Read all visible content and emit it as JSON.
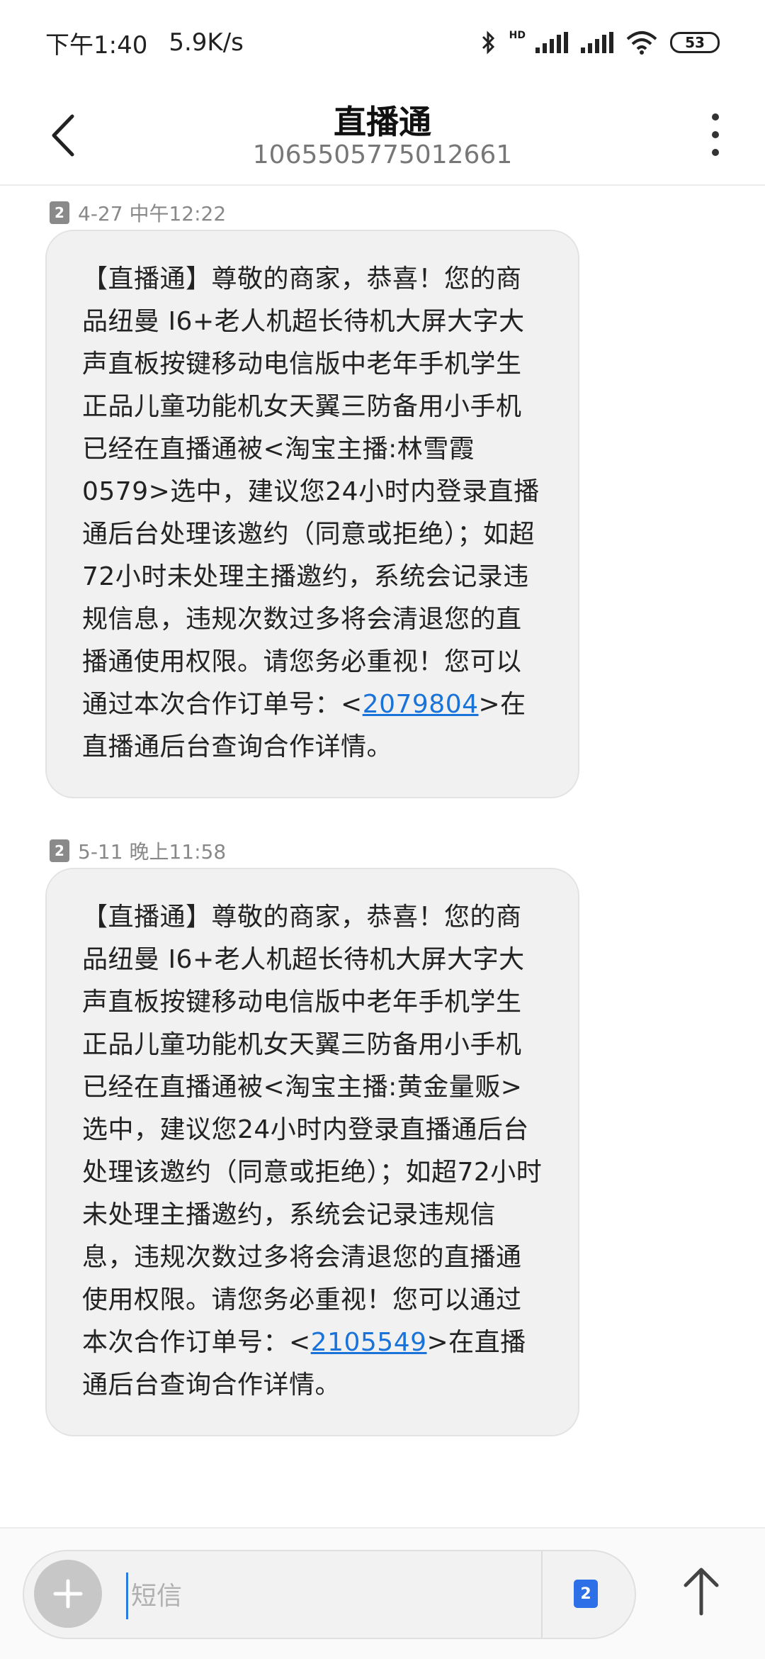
{
  "status_bar": {
    "time": "下午1:40",
    "net_speed": "5.9K/s",
    "hd_label": "HD",
    "battery": "53"
  },
  "header": {
    "title": "直播通",
    "number": "1065505775012661"
  },
  "messages": [
    {
      "sim": "2",
      "timestamp": "4-27 中午12:22",
      "text_before": "【直播通】尊敬的商家，恭喜！您的商品纽曼 I6+老人机超长待机大屏大字大声直板按键移动电信版中老年手机学生正品儿童功能机女天翼三防备用小手机 已经在直播通被<淘宝主播:林雪霞0579>选中，建议您24小时内登录直播通后台处理该邀约（同意或拒绝）；如超72小时未处理主播邀约，系统会记录违规信息，违规次数过多将会清退您的直播通使用权限。请您务必重视！您可以通过本次合作订单号：<",
      "order_link": "2079804",
      "text_after": ">在直播通后台查询合作详情。"
    },
    {
      "sim": "2",
      "timestamp": "5-11 晚上11:58",
      "text_before": "【直播通】尊敬的商家，恭喜！您的商品纽曼 I6+老人机超长待机大屏大字大声直板按键移动电信版中老年手机学生正品儿童功能机女天翼三防备用小手机 已经在直播通被<淘宝主播:黄金量贩>选中，建议您24小时内登录直播通后台处理该邀约（同意或拒绝）；如超72小时未处理主播邀约，系统会记录违规信息，违规次数过多将会清退您的直播通使用权限。请您务必重视！您可以通过本次合作订单号：<",
      "order_link": "2105549",
      "text_after": ">在直播通后台查询合作详情。"
    }
  ],
  "composer": {
    "placeholder": "短信",
    "sim": "2"
  }
}
